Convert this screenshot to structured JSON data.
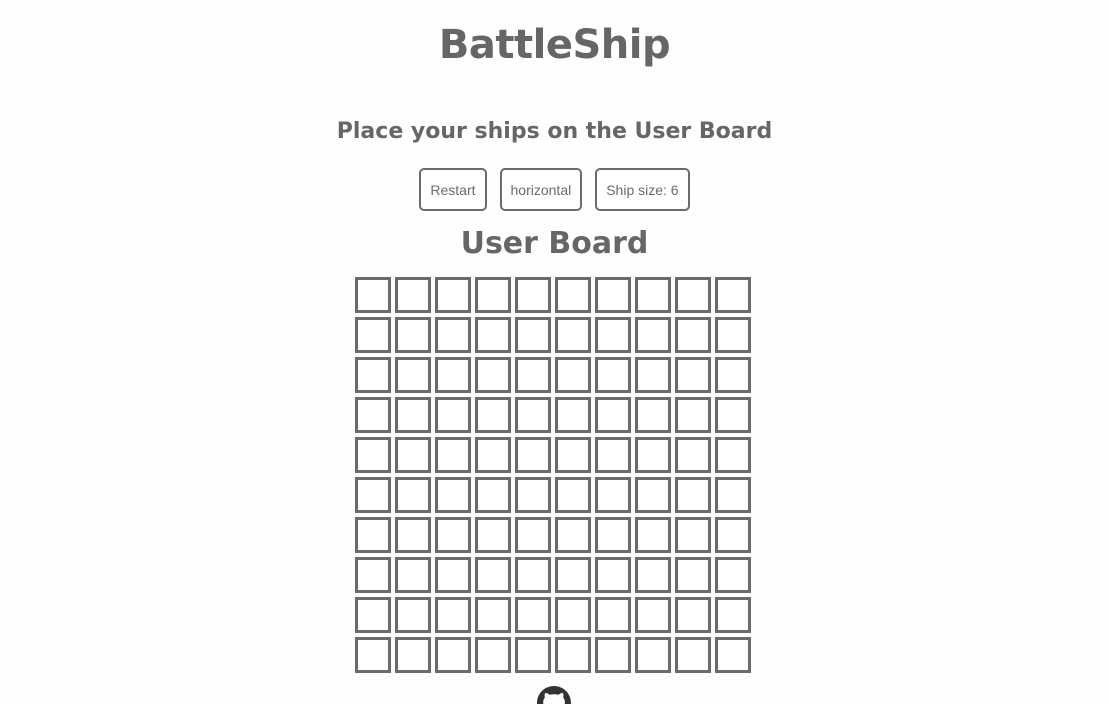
{
  "app": {
    "title": "BattleShip"
  },
  "status": {
    "instructions": "Place your ships on the User Board"
  },
  "controls": {
    "restart_label": "Restart",
    "orientation_label": "horizontal",
    "ship_size_label": "Ship size: 6"
  },
  "board": {
    "title": "User Board",
    "rows": 10,
    "cols": 10,
    "cells": [
      [
        "",
        "",
        "",
        "",
        "",
        "",
        "",
        "",
        "",
        ""
      ],
      [
        "",
        "",
        "",
        "",
        "",
        "",
        "",
        "",
        "",
        ""
      ],
      [
        "",
        "",
        "",
        "",
        "",
        "",
        "",
        "",
        "",
        ""
      ],
      [
        "",
        "",
        "",
        "",
        "",
        "",
        "",
        "",
        "",
        ""
      ],
      [
        "",
        "",
        "",
        "",
        "",
        "",
        "",
        "",
        "",
        ""
      ],
      [
        "",
        "",
        "",
        "",
        "",
        "",
        "",
        "",
        "",
        ""
      ],
      [
        "",
        "",
        "",
        "",
        "",
        "",
        "",
        "",
        "",
        ""
      ],
      [
        "",
        "",
        "",
        "",
        "",
        "",
        "",
        "",
        "",
        ""
      ],
      [
        "",
        "",
        "",
        "",
        "",
        "",
        "",
        "",
        "",
        ""
      ],
      [
        "",
        "",
        "",
        "",
        "",
        "",
        "",
        "",
        "",
        ""
      ]
    ]
  },
  "footer": {
    "icon": "github-icon"
  },
  "colors": {
    "text": "#666666",
    "border": "#6b6b6b",
    "background": "#fefefe",
    "cell": "#ffffff"
  }
}
